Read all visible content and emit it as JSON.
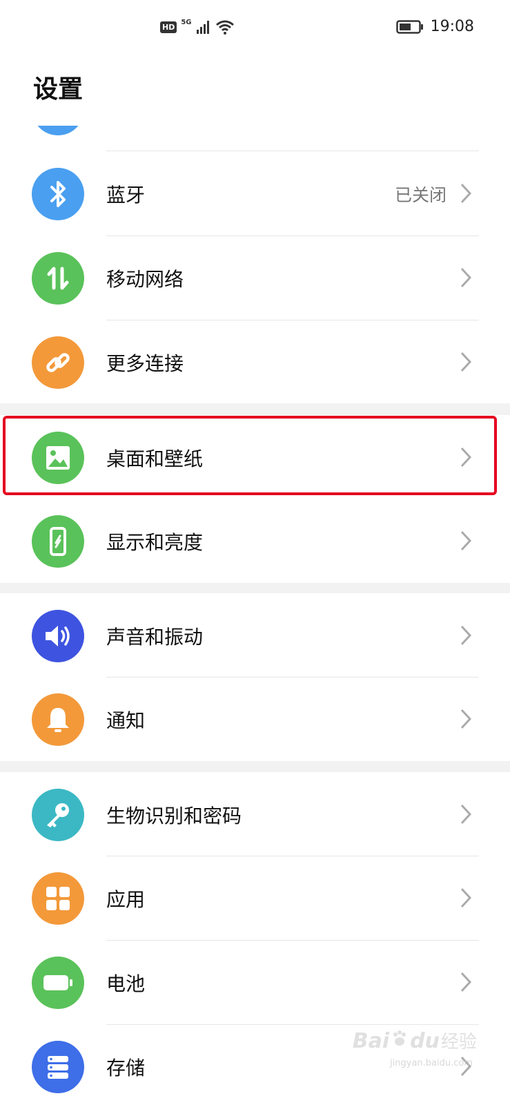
{
  "status_bar": {
    "hd": "HD",
    "network": "5G",
    "time": "19:08"
  },
  "header": {
    "title": "设置"
  },
  "rows": {
    "bluetooth": {
      "label": "蓝牙",
      "value": "已关闭",
      "icon": "bluetooth-icon",
      "color": "#4a9ff0"
    },
    "mobile_network": {
      "label": "移动网络",
      "icon": "mobile-data-icon",
      "color": "#5ac25a"
    },
    "more_connections": {
      "label": "更多连接",
      "icon": "link-icon",
      "color": "#f3993a"
    },
    "home_wallpaper": {
      "label": "桌面和壁纸",
      "icon": "image-icon",
      "color": "#5ac25a"
    },
    "display_brightness": {
      "label": "显示和亮度",
      "icon": "phone-display-icon",
      "color": "#5ac25a"
    },
    "sound_vibration": {
      "label": "声音和振动",
      "icon": "speaker-icon",
      "color": "#3e54e0"
    },
    "notifications": {
      "label": "通知",
      "icon": "bell-icon",
      "color": "#f3993a"
    },
    "biometrics_password": {
      "label": "生物识别和密码",
      "icon": "key-icon",
      "color": "#3bb8c4"
    },
    "apps": {
      "label": "应用",
      "icon": "apps-grid-icon",
      "color": "#f3993a"
    },
    "battery": {
      "label": "电池",
      "icon": "battery-icon",
      "color": "#5ac25a"
    },
    "storage": {
      "label": "存储",
      "icon": "storage-icon",
      "color": "#3e6ee8"
    }
  },
  "watermark": {
    "brand": "Bai",
    "brand2": "du",
    "text": "经验",
    "url": "jingyan.baidu.com"
  }
}
